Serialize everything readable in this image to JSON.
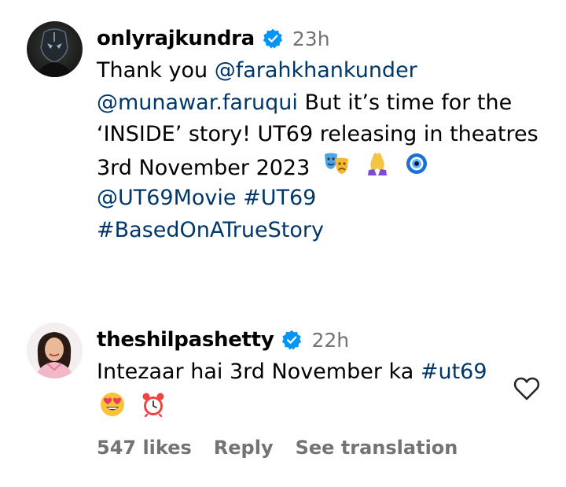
{
  "comments": [
    {
      "username": "onlyrajkundra",
      "time": "23h",
      "text_segments": {
        "thank": "Thank you ",
        "mention1": "@farahkhankunder",
        "mention2": "@munawar.faruqui",
        "rest1": " But it’s time for the",
        "rest2": "‘INSIDE’ story! UT69 releasing in theatres",
        "rest3": "3rd November 2023",
        "mention3": "@UT69Movie",
        "space": " ",
        "hashtag1": "#UT69",
        "hashtag2": "#BasedOnATrueStory"
      },
      "emojis": [
        "performing-arts-icon",
        "folded-hands-icon",
        "nazar-amulet-icon"
      ]
    },
    {
      "username": "theshilpashetty",
      "time": "22h",
      "text_segments": {
        "main": "Intezaar hai 3rd November ka ",
        "hashtag": "#ut69"
      },
      "emojis": [
        "heart-eyes-icon",
        "alarm-clock-icon"
      ],
      "actions": {
        "likes": "547 likes",
        "reply": "Reply",
        "translate": "See translation"
      }
    }
  ],
  "colors": {
    "link": "#00376b",
    "muted": "#737373",
    "verified": "#0095f6"
  }
}
